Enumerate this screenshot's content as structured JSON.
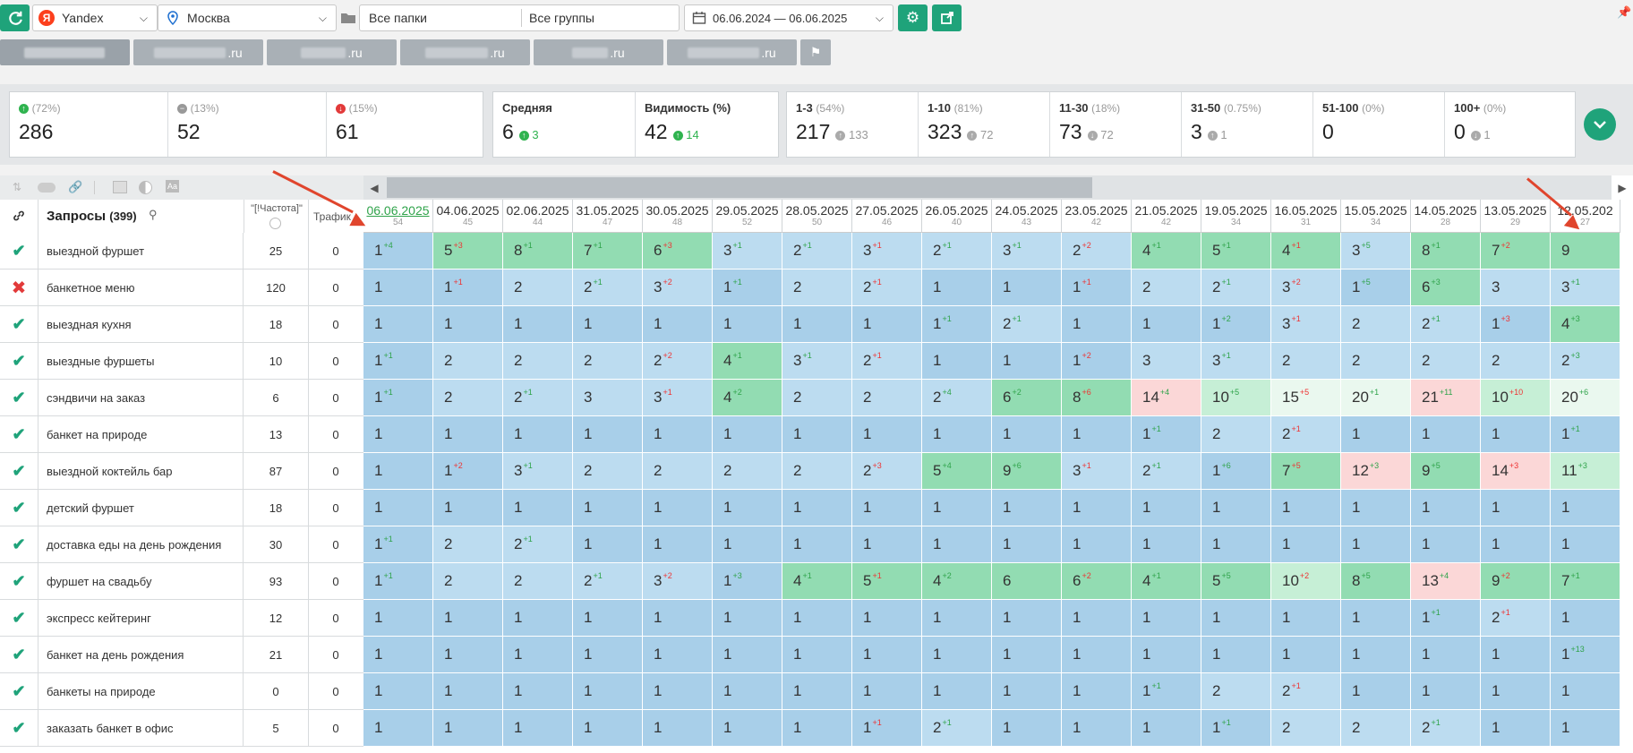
{
  "toolbar": {
    "engine": "Yandex",
    "region": "Москва",
    "folders": "Все папки",
    "groups": "Все группы",
    "date_range": "06.06.2024 — 06.06.2025"
  },
  "site_tabs": [
    ".ru",
    ".ru",
    ".ru",
    ".ru",
    ".ru"
  ],
  "stats_left": [
    {
      "pct": "(72%)",
      "value": "286",
      "icon": "arrow-up-circle-icon",
      "color": "#2fb34f"
    },
    {
      "pct": "(13%)",
      "value": "52",
      "icon": "minus-circle-icon",
      "color": "#999999"
    },
    {
      "pct": "(15%)",
      "value": "61",
      "icon": "arrow-down-circle-icon",
      "color": "#e23a3a"
    }
  ],
  "stats_mid": [
    {
      "label": "Средняя",
      "value": "6",
      "delta": "3"
    },
    {
      "label": "Видимость (%)",
      "value": "42",
      "delta": "14"
    }
  ],
  "stats_right": [
    {
      "label": "1-3",
      "pct": "(54%)",
      "value": "217",
      "delta": "133",
      "dir": "up"
    },
    {
      "label": "1-10",
      "pct": "(81%)",
      "value": "323",
      "delta": "72",
      "dir": "up"
    },
    {
      "label": "11-30",
      "pct": "(18%)",
      "value": "73",
      "delta": "72",
      "dir": "down"
    },
    {
      "label": "31-50",
      "pct": "(0.75%)",
      "value": "3",
      "delta": "1",
      "dir": "up"
    },
    {
      "label": "51-100",
      "pct": "(0%)",
      "value": "0",
      "delta": "",
      "dir": ""
    },
    {
      "label": "100+",
      "pct": "(0%)",
      "value": "0",
      "delta": "1",
      "dir": "down"
    }
  ],
  "table": {
    "queries_title": "Запросы",
    "queries_count": "(399)",
    "freq_header": "\"[!Частота]\"",
    "traffic_header": "Трафик",
    "dates": [
      {
        "d": "06.06.2025",
        "n": "54"
      },
      {
        "d": "04.06.2025",
        "n": "45"
      },
      {
        "d": "02.06.2025",
        "n": "44"
      },
      {
        "d": "31.05.2025",
        "n": "47"
      },
      {
        "d": "30.05.2025",
        "n": "48"
      },
      {
        "d": "29.05.2025",
        "n": "52"
      },
      {
        "d": "28.05.2025",
        "n": "50"
      },
      {
        "d": "27.05.2025",
        "n": "46"
      },
      {
        "d": "26.05.2025",
        "n": "40"
      },
      {
        "d": "24.05.2025",
        "n": "43"
      },
      {
        "d": "23.05.2025",
        "n": "42"
      },
      {
        "d": "21.05.2025",
        "n": "42"
      },
      {
        "d": "19.05.2025",
        "n": "34"
      },
      {
        "d": "16.05.2025",
        "n": "31"
      },
      {
        "d": "15.05.2025",
        "n": "34"
      },
      {
        "d": "14.05.2025",
        "n": "28"
      },
      {
        "d": "13.05.2025",
        "n": "29"
      },
      {
        "d": "12.05.202",
        "n": "27"
      }
    ],
    "rows": [
      {
        "q": "выездной фуршет",
        "ok": true,
        "f": "25",
        "t": "0",
        "cells": [
          "1|+4",
          "5|+3",
          "8|+1",
          "7|+1",
          "6|+3",
          "3|+1",
          "2|+1",
          "3|+1",
          "2|+1",
          "3|+1",
          "2|+2",
          "4|+1",
          "5|+1",
          "4|+1",
          "3|+5",
          "8|+1",
          "7|+2",
          "9|"
        ]
      },
      {
        "q": "банкетное меню",
        "ok": false,
        "f": "120",
        "t": "0",
        "cells": [
          "1|",
          "1|+1",
          "2|",
          "2|+1",
          "3|+2",
          "1|+1",
          "2|",
          "2|+1",
          "1|",
          "1|",
          "1|+1",
          "2|",
          "2|+1",
          "3|+2",
          "1|+5",
          "6|+3",
          "3|",
          "3|+1"
        ]
      },
      {
        "q": "выездная кухня",
        "ok": true,
        "f": "18",
        "t": "0",
        "cells": [
          "1|",
          "1|",
          "1|",
          "1|",
          "1|",
          "1|",
          "1|",
          "1|",
          "1|+1",
          "2|+1",
          "1|",
          "1|",
          "1|+2",
          "3|+1",
          "2|",
          "2|+1",
          "1|+3",
          "4|+3"
        ]
      },
      {
        "q": "выездные фуршеты",
        "ok": true,
        "f": "10",
        "t": "0",
        "cells": [
          "1|+1",
          "2|",
          "2|",
          "2|",
          "2|+2",
          "4|+1",
          "3|+1",
          "2|+1",
          "1|",
          "1|",
          "1|+2",
          "3|",
          "3|+1",
          "2|",
          "2|",
          "2|",
          "2|",
          "2|+3"
        ]
      },
      {
        "q": "сэндвичи на заказ",
        "ok": true,
        "f": "6",
        "t": "0",
        "cells": [
          "1|+1",
          "2|",
          "2|+1",
          "3|",
          "3|+1",
          "4|+2",
          "2|",
          "2|",
          "2|+4",
          "6|+2",
          "8|+6",
          "14|+4",
          "10|+5",
          "15|+5",
          "20|+1",
          "21|+11",
          "10|+10",
          "20|+6"
        ]
      },
      {
        "q": "банкет на природе",
        "ok": true,
        "f": "13",
        "t": "0",
        "cells": [
          "1|",
          "1|",
          "1|",
          "1|",
          "1|",
          "1|",
          "1|",
          "1|",
          "1|",
          "1|",
          "1|",
          "1|+1",
          "2|",
          "2|+1",
          "1|",
          "1|",
          "1|",
          "1|+1"
        ]
      },
      {
        "q": "выездной коктейль бар",
        "ok": true,
        "f": "87",
        "t": "0",
        "cells": [
          "1|",
          "1|+2",
          "3|+1",
          "2|",
          "2|",
          "2|",
          "2|",
          "2|+3",
          "5|+4",
          "9|+6",
          "3|+1",
          "2|+1",
          "1|+6",
          "7|+5",
          "12|+3",
          "9|+5",
          "14|+3",
          "11|+3"
        ]
      },
      {
        "q": "детский фуршет",
        "ok": true,
        "f": "18",
        "t": "0",
        "cells": [
          "1|",
          "1|",
          "1|",
          "1|",
          "1|",
          "1|",
          "1|",
          "1|",
          "1|",
          "1|",
          "1|",
          "1|",
          "1|",
          "1|",
          "1|",
          "1|",
          "1|",
          "1|"
        ]
      },
      {
        "q": "доставка еды на день рождения",
        "ok": true,
        "f": "30",
        "t": "0",
        "cells": [
          "1|+1",
          "2|",
          "2|+1",
          "1|",
          "1|",
          "1|",
          "1|",
          "1|",
          "1|",
          "1|",
          "1|",
          "1|",
          "1|",
          "1|",
          "1|",
          "1|",
          "1|",
          "1|"
        ]
      },
      {
        "q": "фуршет на свадьбу",
        "ok": true,
        "f": "93",
        "t": "0",
        "cells": [
          "1|+1",
          "2|",
          "2|",
          "2|+1",
          "3|+2",
          "1|+3",
          "4|+1",
          "5|+1",
          "4|+2",
          "6|",
          "6|+2",
          "4|+1",
          "5|+5",
          "10|+2",
          "8|+5",
          "13|+4",
          "9|+2",
          "7|+1"
        ]
      },
      {
        "q": "экспресс кейтеринг",
        "ok": true,
        "f": "12",
        "t": "0",
        "cells": [
          "1|",
          "1|",
          "1|",
          "1|",
          "1|",
          "1|",
          "1|",
          "1|",
          "1|",
          "1|",
          "1|",
          "1|",
          "1|",
          "1|",
          "1|",
          "1|+1",
          "2|+1",
          "1|"
        ]
      },
      {
        "q": "банкет на день рождения",
        "ok": true,
        "f": "21",
        "t": "0",
        "cells": [
          "1|",
          "1|",
          "1|",
          "1|",
          "1|",
          "1|",
          "1|",
          "1|",
          "1|",
          "1|",
          "1|",
          "1|",
          "1|",
          "1|",
          "1|",
          "1|",
          "1|",
          "1|+13"
        ]
      },
      {
        "q": "банкеты на природе",
        "ok": true,
        "f": "0",
        "t": "0",
        "cells": [
          "1|",
          "1|",
          "1|",
          "1|",
          "1|",
          "1|",
          "1|",
          "1|",
          "1|",
          "1|",
          "1|",
          "1|+1",
          "2|",
          "2|+1",
          "1|",
          "1|",
          "1|",
          "1|"
        ]
      },
      {
        "q": "заказать банкет в офис",
        "ok": true,
        "f": "5",
        "t": "0",
        "cells": [
          "1|",
          "1|",
          "1|",
          "1|",
          "1|",
          "1|",
          "1|",
          "1|+1",
          "2|+1",
          "1|",
          "1|",
          "1|",
          "1|+1",
          "2|",
          "2|",
          "2|+1",
          "1|",
          "1|"
        ]
      }
    ]
  },
  "colors": {
    "accent": "#1fa37a",
    "top_blue": "#a8cfe9",
    "light_blue": "#bcdcf0",
    "green": "#92dcb2",
    "light_green": "#c6efd6",
    "pink": "#fbd7d7",
    "pale": "#eaf8ef"
  }
}
